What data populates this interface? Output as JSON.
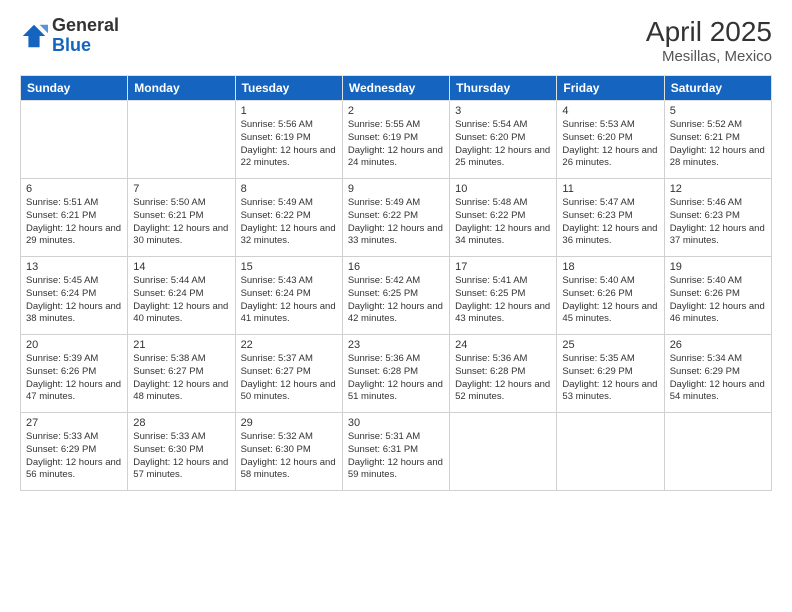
{
  "header": {
    "logo_general": "General",
    "logo_blue": "Blue",
    "title": "April 2025",
    "subtitle": "Mesillas, Mexico"
  },
  "days_of_week": [
    "Sunday",
    "Monday",
    "Tuesday",
    "Wednesday",
    "Thursday",
    "Friday",
    "Saturday"
  ],
  "weeks": [
    [
      {
        "day": "",
        "info": ""
      },
      {
        "day": "",
        "info": ""
      },
      {
        "day": "1",
        "info": "Sunrise: 5:56 AM\nSunset: 6:19 PM\nDaylight: 12 hours and 22 minutes."
      },
      {
        "day": "2",
        "info": "Sunrise: 5:55 AM\nSunset: 6:19 PM\nDaylight: 12 hours and 24 minutes."
      },
      {
        "day": "3",
        "info": "Sunrise: 5:54 AM\nSunset: 6:20 PM\nDaylight: 12 hours and 25 minutes."
      },
      {
        "day": "4",
        "info": "Sunrise: 5:53 AM\nSunset: 6:20 PM\nDaylight: 12 hours and 26 minutes."
      },
      {
        "day": "5",
        "info": "Sunrise: 5:52 AM\nSunset: 6:21 PM\nDaylight: 12 hours and 28 minutes."
      }
    ],
    [
      {
        "day": "6",
        "info": "Sunrise: 5:51 AM\nSunset: 6:21 PM\nDaylight: 12 hours and 29 minutes."
      },
      {
        "day": "7",
        "info": "Sunrise: 5:50 AM\nSunset: 6:21 PM\nDaylight: 12 hours and 30 minutes."
      },
      {
        "day": "8",
        "info": "Sunrise: 5:49 AM\nSunset: 6:22 PM\nDaylight: 12 hours and 32 minutes."
      },
      {
        "day": "9",
        "info": "Sunrise: 5:49 AM\nSunset: 6:22 PM\nDaylight: 12 hours and 33 minutes."
      },
      {
        "day": "10",
        "info": "Sunrise: 5:48 AM\nSunset: 6:22 PM\nDaylight: 12 hours and 34 minutes."
      },
      {
        "day": "11",
        "info": "Sunrise: 5:47 AM\nSunset: 6:23 PM\nDaylight: 12 hours and 36 minutes."
      },
      {
        "day": "12",
        "info": "Sunrise: 5:46 AM\nSunset: 6:23 PM\nDaylight: 12 hours and 37 minutes."
      }
    ],
    [
      {
        "day": "13",
        "info": "Sunrise: 5:45 AM\nSunset: 6:24 PM\nDaylight: 12 hours and 38 minutes."
      },
      {
        "day": "14",
        "info": "Sunrise: 5:44 AM\nSunset: 6:24 PM\nDaylight: 12 hours and 40 minutes."
      },
      {
        "day": "15",
        "info": "Sunrise: 5:43 AM\nSunset: 6:24 PM\nDaylight: 12 hours and 41 minutes."
      },
      {
        "day": "16",
        "info": "Sunrise: 5:42 AM\nSunset: 6:25 PM\nDaylight: 12 hours and 42 minutes."
      },
      {
        "day": "17",
        "info": "Sunrise: 5:41 AM\nSunset: 6:25 PM\nDaylight: 12 hours and 43 minutes."
      },
      {
        "day": "18",
        "info": "Sunrise: 5:40 AM\nSunset: 6:26 PM\nDaylight: 12 hours and 45 minutes."
      },
      {
        "day": "19",
        "info": "Sunrise: 5:40 AM\nSunset: 6:26 PM\nDaylight: 12 hours and 46 minutes."
      }
    ],
    [
      {
        "day": "20",
        "info": "Sunrise: 5:39 AM\nSunset: 6:26 PM\nDaylight: 12 hours and 47 minutes."
      },
      {
        "day": "21",
        "info": "Sunrise: 5:38 AM\nSunset: 6:27 PM\nDaylight: 12 hours and 48 minutes."
      },
      {
        "day": "22",
        "info": "Sunrise: 5:37 AM\nSunset: 6:27 PM\nDaylight: 12 hours and 50 minutes."
      },
      {
        "day": "23",
        "info": "Sunrise: 5:36 AM\nSunset: 6:28 PM\nDaylight: 12 hours and 51 minutes."
      },
      {
        "day": "24",
        "info": "Sunrise: 5:36 AM\nSunset: 6:28 PM\nDaylight: 12 hours and 52 minutes."
      },
      {
        "day": "25",
        "info": "Sunrise: 5:35 AM\nSunset: 6:29 PM\nDaylight: 12 hours and 53 minutes."
      },
      {
        "day": "26",
        "info": "Sunrise: 5:34 AM\nSunset: 6:29 PM\nDaylight: 12 hours and 54 minutes."
      }
    ],
    [
      {
        "day": "27",
        "info": "Sunrise: 5:33 AM\nSunset: 6:29 PM\nDaylight: 12 hours and 56 minutes."
      },
      {
        "day": "28",
        "info": "Sunrise: 5:33 AM\nSunset: 6:30 PM\nDaylight: 12 hours and 57 minutes."
      },
      {
        "day": "29",
        "info": "Sunrise: 5:32 AM\nSunset: 6:30 PM\nDaylight: 12 hours and 58 minutes."
      },
      {
        "day": "30",
        "info": "Sunrise: 5:31 AM\nSunset: 6:31 PM\nDaylight: 12 hours and 59 minutes."
      },
      {
        "day": "",
        "info": ""
      },
      {
        "day": "",
        "info": ""
      },
      {
        "day": "",
        "info": ""
      }
    ]
  ]
}
